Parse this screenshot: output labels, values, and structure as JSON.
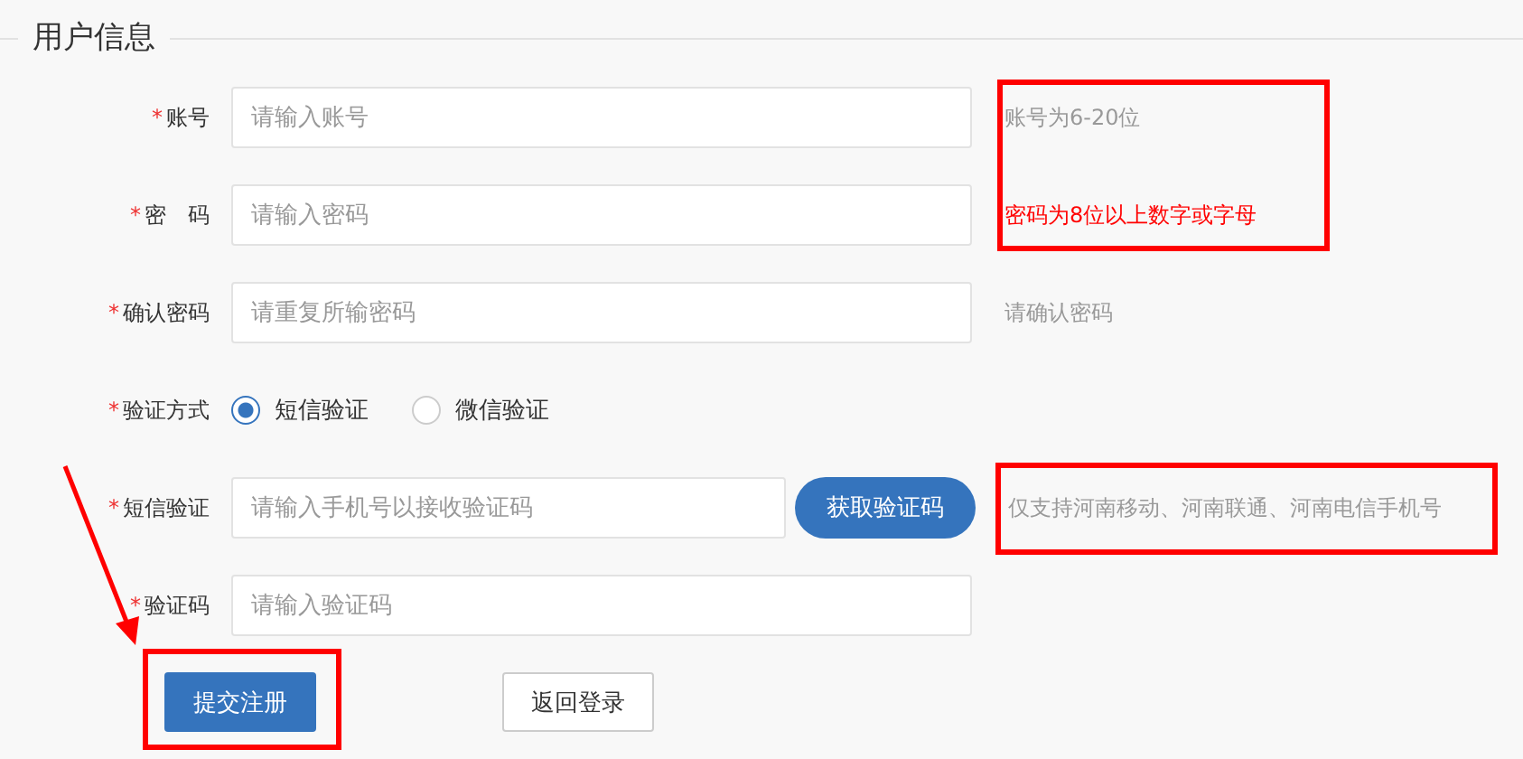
{
  "section": {
    "title": "用户信息"
  },
  "fields": [
    {
      "kind": "input",
      "mark": "*",
      "label": "账号",
      "placeholder": "请输入账号",
      "hint": {
        "text": "账号为6-20位",
        "kind": "note"
      }
    },
    {
      "kind": "input",
      "mark": "*",
      "label": "密　码",
      "placeholder": "请输入密码",
      "hint": {
        "text": "密码为8位以上数字或字母",
        "kind": "warning"
      }
    },
    {
      "kind": "input",
      "mark": "*",
      "label": "确认密码",
      "placeholder": "请重复所输密码",
      "hint": {
        "text": "请确认密码",
        "kind": "note"
      }
    },
    {
      "kind": "radio",
      "mark": "*",
      "label": "验证方式",
      "options": [
        {
          "label": "短信验证",
          "selected": true
        },
        {
          "label": "微信验证",
          "selected": false
        }
      ]
    },
    {
      "kind": "sms",
      "mark": "*",
      "label": "短信验证",
      "placeholder": "请输入手机号以接收验证码",
      "button": "获取验证码",
      "hint": {
        "text": "仅支持河南移动、河南联通、河南电信手机号",
        "kind": "note"
      }
    },
    {
      "kind": "input",
      "mark": "*",
      "label": "验证码",
      "placeholder": "请输入验证码"
    }
  ],
  "buttons": [
    {
      "label": "提交注册",
      "kind": "primary"
    },
    {
      "label": "返回登录",
      "kind": "plain"
    }
  ]
}
